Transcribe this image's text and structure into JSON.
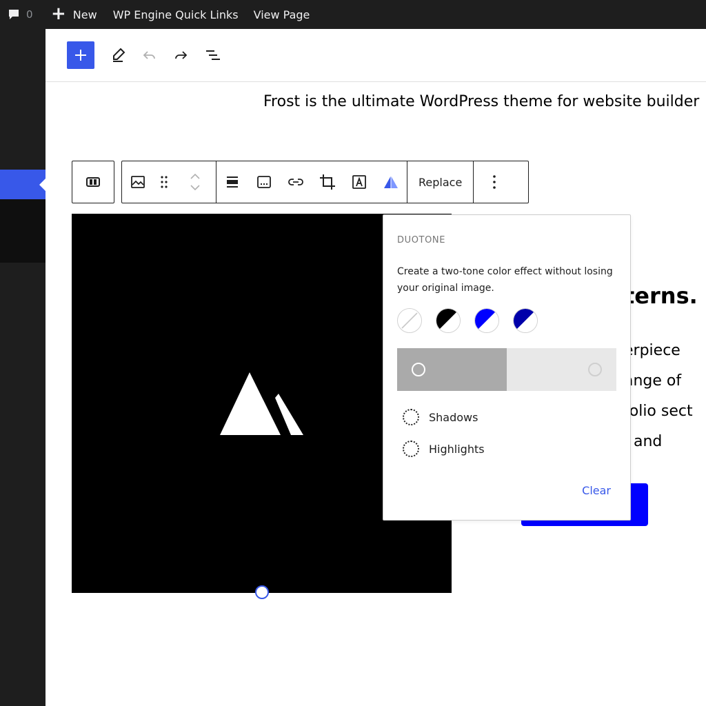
{
  "admin_bar": {
    "comment_count": "0",
    "new_label": "New",
    "quick_links_label": "WP Engine Quick Links",
    "view_page_label": "View Page"
  },
  "canvas": {
    "intro_text": "Frost is the ultimate WordPress theme for website builder",
    "heading_fragment": "terns.",
    "text_fragments": [
      "erpiece",
      "ange of",
      "folio sect",
      ", and"
    ]
  },
  "toolbar": {
    "replace_label": "Replace"
  },
  "duotone": {
    "title": "DUOTONE",
    "description": "Create a two-tone color effect without losing your original image.",
    "swatches": [
      {
        "name": "unset",
        "dark": "#ffffff",
        "light": "#ffffff"
      },
      {
        "name": "black-white",
        "dark": "#000000",
        "light": "#ffffff"
      },
      {
        "name": "blue-white",
        "dark": "#0000ff",
        "light": "#ffffff"
      },
      {
        "name": "navy-white",
        "dark": "#0000aa",
        "light": "#ffffff"
      }
    ],
    "shadows_label": "Shadows",
    "highlights_label": "Highlights",
    "clear_label": "Clear"
  },
  "colors": {
    "accent": "#3858e9",
    "admin_bar": "#1e1e1e",
    "cta_button": "#0000ff"
  }
}
